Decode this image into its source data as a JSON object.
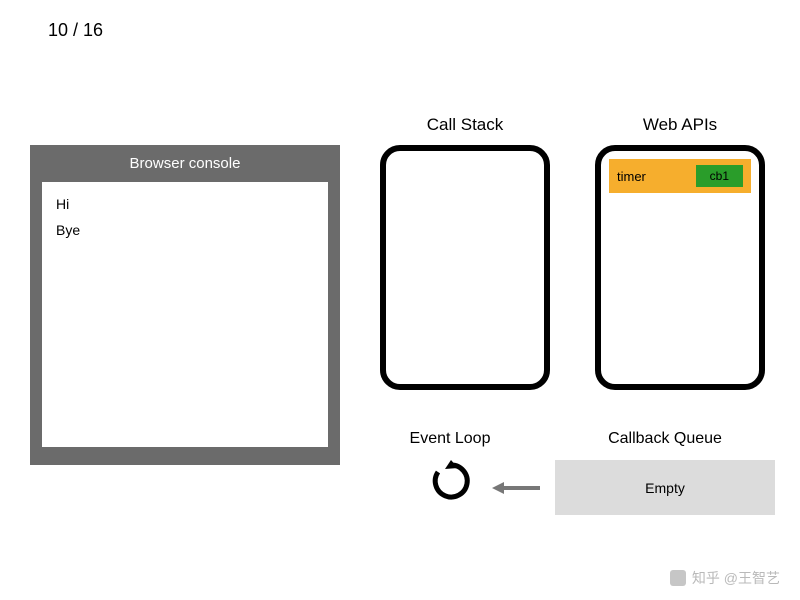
{
  "counter": {
    "current": 10,
    "total": 16,
    "display": "10 / 16"
  },
  "console": {
    "title": "Browser console",
    "lines": [
      "Hi",
      "Bye"
    ]
  },
  "call_stack": {
    "label": "Call Stack",
    "items": []
  },
  "web_apis": {
    "label": "Web APIs",
    "items": [
      {
        "kind": "timer",
        "callback": "cb1"
      }
    ]
  },
  "event_loop": {
    "label": "Event Loop"
  },
  "callback_queue": {
    "label": "Callback Queue",
    "content": "Empty"
  },
  "watermark": {
    "text": "知乎 @王智艺"
  },
  "colors": {
    "console_frame": "#6b6b6b",
    "timer_bg": "#f6ae2d",
    "callback_bg": "#2a9d2a",
    "queue_bg": "#dcdcdc"
  }
}
